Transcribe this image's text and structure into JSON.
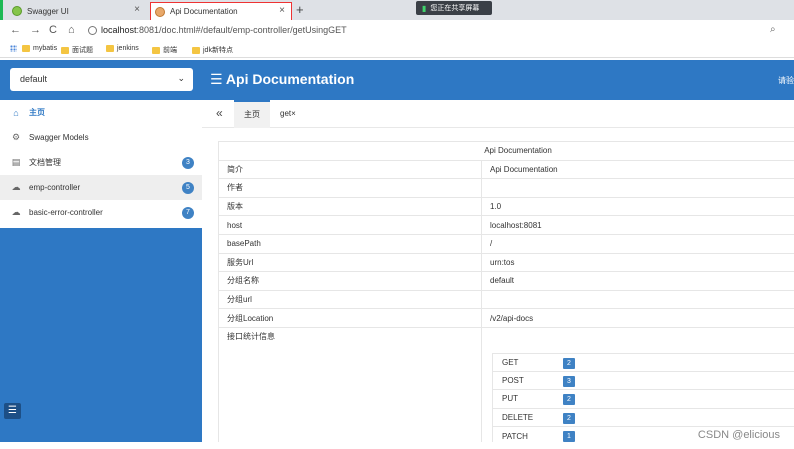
{
  "browser": {
    "tabs": [
      {
        "title": "Swagger UI",
        "close": "×"
      },
      {
        "title": "Api Documentation",
        "close": "×"
      }
    ],
    "new_tab": "+",
    "share_text": "您正在共享屏幕",
    "nav": {
      "back": "←",
      "forward": "→",
      "reload": "C",
      "home": "⌂"
    },
    "url_host": "localhost",
    "url_rest": ":8081/doc.html#/default/emp-controller/getUsingGET",
    "bookmarks": [
      "mybatis",
      "面试题",
      "jenkins",
      "前端",
      "jdk新特点"
    ]
  },
  "sidebar": {
    "group_select": "default",
    "items": [
      {
        "label": "主页",
        "icon": "home-icon"
      },
      {
        "label": "Swagger Models",
        "icon": "models-icon"
      },
      {
        "label": "文档管理",
        "icon": "document-icon",
        "badge": "3"
      },
      {
        "label": "emp-controller",
        "icon": "cloud-icon",
        "badge": "5"
      },
      {
        "label": "basic-error-controller",
        "icon": "cloud-icon",
        "badge": "7"
      }
    ]
  },
  "header": {
    "title": "☰ Api Documentation",
    "right_text": "请验"
  },
  "tabstrip": {
    "back": "«",
    "tabs": [
      "主页",
      "get×"
    ]
  },
  "info_table": {
    "heading": "Api Documentation",
    "rows": [
      {
        "key": "简介",
        "value": "Api Documentation"
      },
      {
        "key": "作者",
        "value": ""
      },
      {
        "key": "版本",
        "value": "1.0"
      },
      {
        "key": "host",
        "value": "localhost:8081"
      },
      {
        "key": "basePath",
        "value": "/"
      },
      {
        "key": "服务Url",
        "value": "urn:tos"
      },
      {
        "key": "分组名称",
        "value": "default"
      },
      {
        "key": "分组url",
        "value": ""
      },
      {
        "key": "分组Location",
        "value": "/v2/api-docs"
      },
      {
        "key": "接口统计信息",
        "value": ""
      }
    ]
  },
  "stats": [
    {
      "method": "GET",
      "count": "2"
    },
    {
      "method": "POST",
      "count": "3"
    },
    {
      "method": "PUT",
      "count": "2"
    },
    {
      "method": "DELETE",
      "count": "2"
    },
    {
      "method": "PATCH",
      "count": "1"
    }
  ],
  "watermark": "CSDN @elicious",
  "colors": {
    "primary": "#2e78c4",
    "badge": "#3f82c4"
  }
}
